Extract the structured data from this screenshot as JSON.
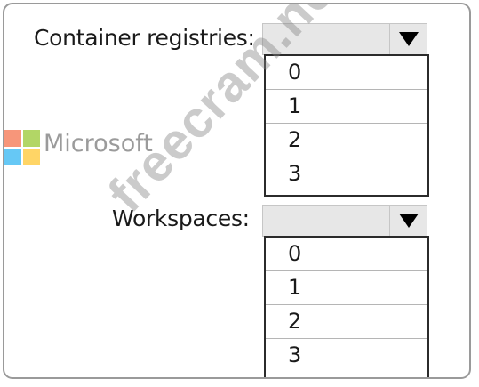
{
  "container_registries": {
    "label": "Container registries:",
    "selected": "",
    "options": [
      "0",
      "1",
      "2",
      "3"
    ]
  },
  "workspaces": {
    "label": "Workspaces:",
    "selected": "",
    "options": [
      "0",
      "1",
      "2",
      "3"
    ]
  },
  "watermarks": {
    "logo_text": "Microsoft",
    "diagonal_text": "freecram.net"
  },
  "colors": {
    "select_bg": "#e7e7e7",
    "list_border": "#2b2b2b",
    "watermark_gray": "#8a8a8a"
  }
}
